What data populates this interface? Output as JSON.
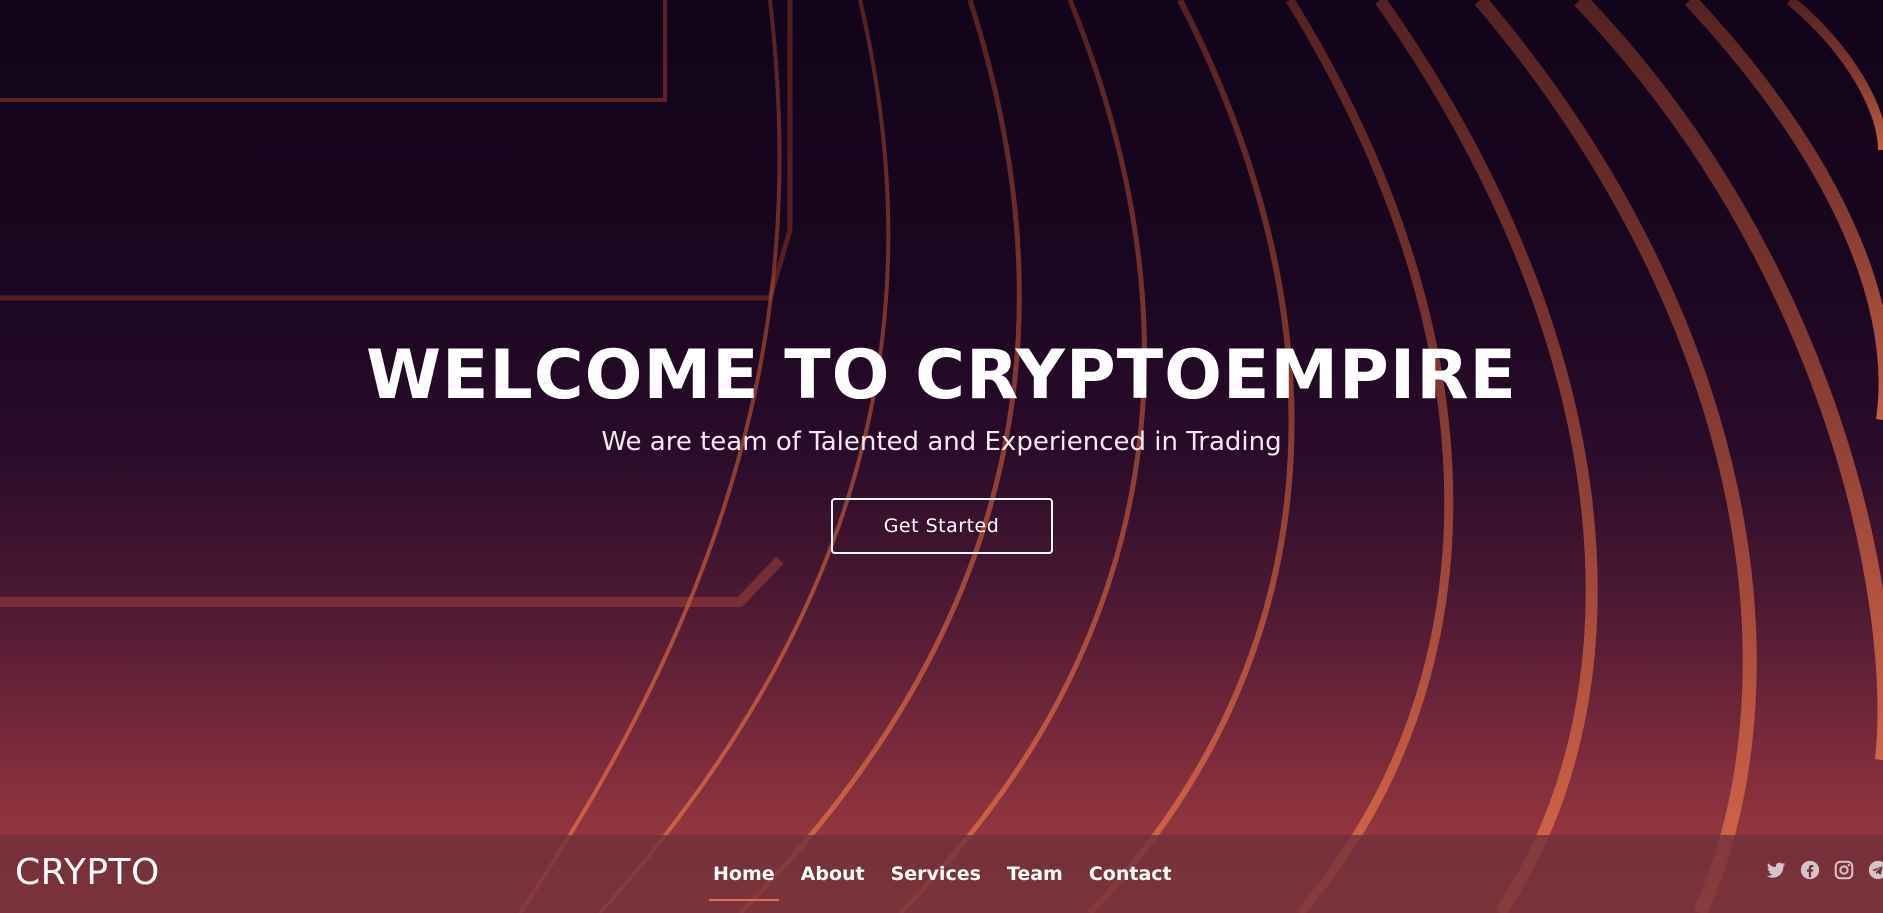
{
  "hero": {
    "title": "WELCOME TO CRYPTOEMPIRE",
    "subtitle": "We are team of Talented and Experienced in Trading",
    "cta_label": "Get Started"
  },
  "navbar": {
    "logo": "CRYPTO",
    "items": [
      {
        "label": "Home",
        "active": true
      },
      {
        "label": "About",
        "active": false
      },
      {
        "label": "Services",
        "active": false
      },
      {
        "label": "Team",
        "active": false
      },
      {
        "label": "Contact",
        "active": false
      }
    ],
    "social": [
      "twitter-icon",
      "facebook-icon",
      "instagram-icon",
      "telegram-icon"
    ]
  },
  "colors": {
    "accent": "#e86c4c",
    "background_top": "#12041a",
    "background_bottom": "#a8403f",
    "navbar": "#6e303a"
  }
}
